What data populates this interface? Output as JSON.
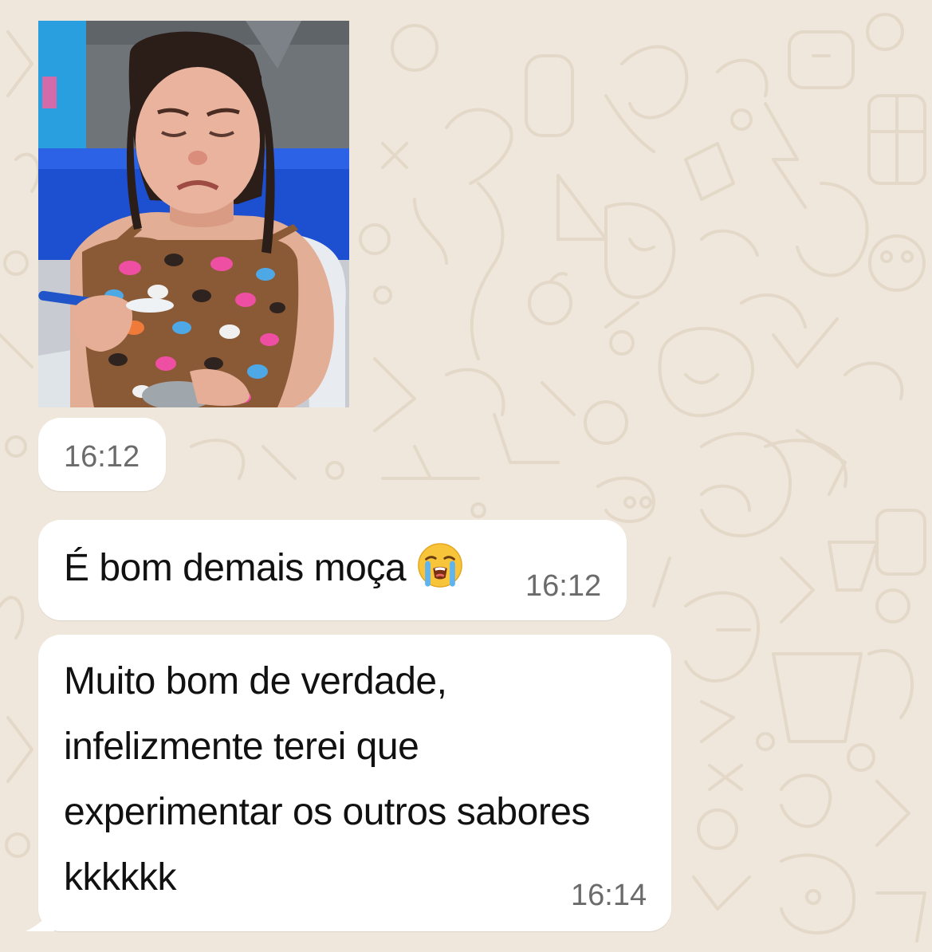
{
  "chat": {
    "wallpaper": {
      "color": "#efe7dc",
      "line_color": "#e4d8c8"
    },
    "messages": [
      {
        "type": "image",
        "image_alt": "crying child photo",
        "time": "16:12"
      },
      {
        "type": "text",
        "text": "É bom demais moça",
        "emoji": "loudly-crying-face-emoji",
        "time": "16:12"
      },
      {
        "type": "text",
        "lines": [
          "Muito bom de verdade,",
          "infelizmente terei que",
          "experimentar os outros sabores",
          "kkkkkk"
        ],
        "time": "16:14"
      }
    ]
  }
}
